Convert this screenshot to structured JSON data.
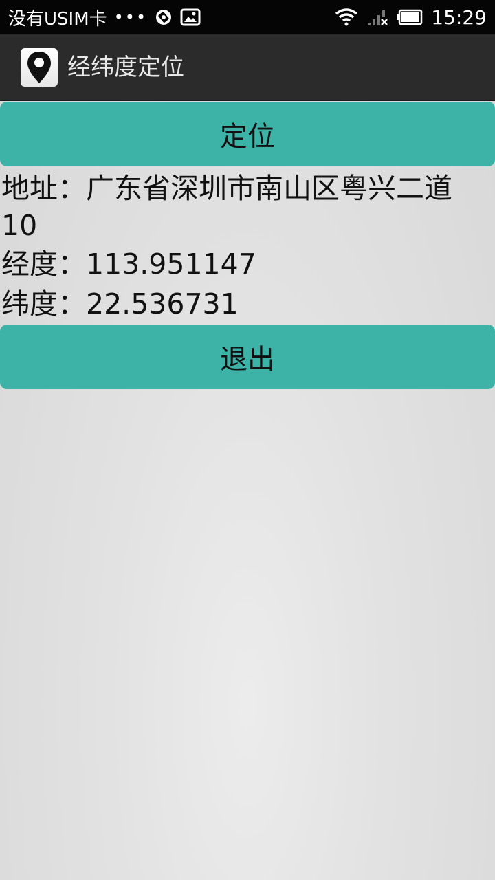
{
  "status_bar": {
    "carrier": "没有USIM卡",
    "dots": "•••",
    "time": "15:29"
  },
  "action_bar": {
    "title": "经纬度定位",
    "icon": "location-pin-icon"
  },
  "buttons": {
    "locate_label": "定位",
    "exit_label": "退出"
  },
  "info": {
    "address_line1": "地址：广东省深圳市南山区粤兴二道",
    "address_line2": "10",
    "longitude": "经度：113.951147",
    "latitude": "纬度：22.536731"
  }
}
